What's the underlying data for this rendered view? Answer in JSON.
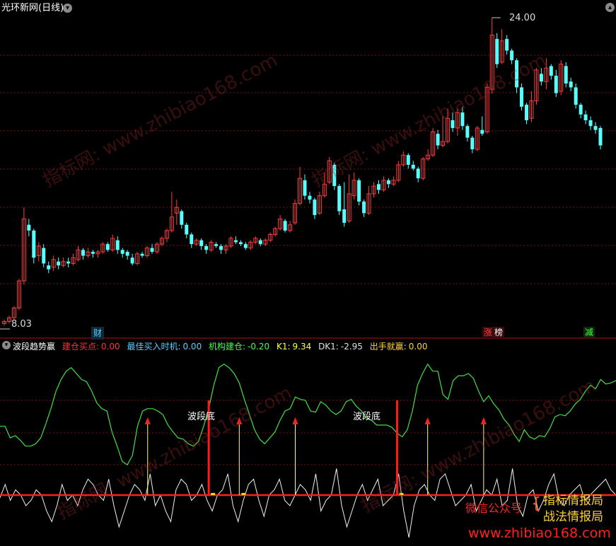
{
  "window": {
    "title": "光环新网(日线)"
  },
  "price_panel": {
    "high_label": "24.00",
    "low_label": "8.03",
    "event_tags": [
      {
        "text": "财",
        "color": "#57d0ff"
      },
      {
        "text": "涨",
        "color": "#ff4040"
      },
      {
        "text": "榜",
        "color": "#ffffff"
      },
      {
        "text": "减",
        "color": "#40ff40"
      }
    ]
  },
  "indicator_panel": {
    "name": "波段趋势赢",
    "fields": [
      {
        "label": "建仓买点:",
        "value": "0.00",
        "color": "#ff3030"
      },
      {
        "label": "最佳买入时机:",
        "value": "0.00",
        "color": "#57d0ff"
      },
      {
        "label": "机构建仓:",
        "value": "-0.20",
        "color": "#40ff40"
      },
      {
        "label": "K1:",
        "value": "9.34",
        "color": "#ffff40"
      },
      {
        "label": "DK1:",
        "value": "-2.95",
        "color": "#e0e0e0"
      },
      {
        "label": "出手就赢:",
        "value": "0.00",
        "color": "#ffd040"
      }
    ],
    "annotations": [
      "波段底",
      "波段底"
    ]
  },
  "watermark": {
    "text": "指标网: www.zhibiao168.com"
  },
  "promo": {
    "wechat": "微信公众号",
    "line1": "指标情报局",
    "line2": "战法情报局",
    "url": "www.zhibiao168.com"
  },
  "colors": {
    "up": "#ff3c3c",
    "down": "#57ffff",
    "grid": "#7a1010"
  },
  "chart_data": {
    "type": "candlestick",
    "price_max": 24.0,
    "price_min": 8.03,
    "candles": [
      [
        8.2,
        8.3,
        8.1,
        8.4
      ],
      [
        8.3,
        8.5,
        8.2,
        8.6
      ],
      [
        8.5,
        9.0,
        8.4,
        9.1
      ],
      [
        9.0,
        10.4,
        8.9,
        10.5
      ],
      [
        10.4,
        13.6,
        10.2,
        14.2
      ],
      [
        13.3,
        13.0,
        12.7,
        13.6
      ],
      [
        13.0,
        11.6,
        11.3,
        13.1
      ],
      [
        11.7,
        12.2,
        11.4,
        12.4
      ],
      [
        12.1,
        11.3,
        11.1,
        12.3
      ],
      [
        11.2,
        11.0,
        10.8,
        11.4
      ],
      [
        11.1,
        11.5,
        10.9,
        11.7
      ],
      [
        11.4,
        11.2,
        11.0,
        11.6
      ],
      [
        11.2,
        11.4,
        11.1,
        11.6
      ],
      [
        11.4,
        11.3,
        11.1,
        11.6
      ],
      [
        11.3,
        11.6,
        11.2,
        11.8
      ],
      [
        11.5,
        12.0,
        11.4,
        12.2
      ],
      [
        12.0,
        11.7,
        11.5,
        12.1
      ],
      [
        11.7,
        11.9,
        11.6,
        12.1
      ],
      [
        11.9,
        11.8,
        11.6,
        12.0
      ],
      [
        11.8,
        11.9,
        11.6,
        12.0
      ],
      [
        11.9,
        12.3,
        11.8,
        12.4
      ],
      [
        12.3,
        12.0,
        11.9,
        12.4
      ],
      [
        12.0,
        12.6,
        11.9,
        12.8
      ],
      [
        12.5,
        12.0,
        11.8,
        12.7
      ],
      [
        12.0,
        11.8,
        11.6,
        12.1
      ],
      [
        11.9,
        11.7,
        11.5,
        12.0
      ],
      [
        11.6,
        11.3,
        11.2,
        11.8
      ],
      [
        11.3,
        11.8,
        11.2,
        11.9
      ],
      [
        11.8,
        11.7,
        11.6,
        11.9
      ],
      [
        11.7,
        12.1,
        11.6,
        12.2
      ],
      [
        12.1,
        11.9,
        11.8,
        12.3
      ],
      [
        11.9,
        12.3,
        11.8,
        12.4
      ],
      [
        12.3,
        12.6,
        12.2,
        12.7
      ],
      [
        12.6,
        13.0,
        12.4,
        13.1
      ],
      [
        13.0,
        13.7,
        12.9,
        15.0
      ],
      [
        13.9,
        14.2,
        13.3,
        14.6
      ],
      [
        14.0,
        13.3,
        13.1,
        14.1
      ],
      [
        13.3,
        12.8,
        12.6,
        13.4
      ],
      [
        12.8,
        12.3,
        12.1,
        12.9
      ],
      [
        12.3,
        12.5,
        12.2,
        12.6
      ],
      [
        12.5,
        12.2,
        12.0,
        12.6
      ],
      [
        12.2,
        12.0,
        11.8,
        12.3
      ],
      [
        12.0,
        12.4,
        11.9,
        12.5
      ],
      [
        12.3,
        12.2,
        12.1,
        12.4
      ],
      [
        12.2,
        12.0,
        11.8,
        12.3
      ],
      [
        12.0,
        12.2,
        11.8,
        12.3
      ],
      [
        12.2,
        12.6,
        12.1,
        12.7
      ],
      [
        12.5,
        12.4,
        12.3,
        12.7
      ],
      [
        12.4,
        12.3,
        12.2,
        12.5
      ],
      [
        12.3,
        12.1,
        12.0,
        12.4
      ],
      [
        12.1,
        12.4,
        12.0,
        12.5
      ],
      [
        12.4,
        12.6,
        12.3,
        12.7
      ],
      [
        12.5,
        12.3,
        12.2,
        12.6
      ],
      [
        12.3,
        12.5,
        12.2,
        12.6
      ],
      [
        12.5,
        12.8,
        12.4,
        12.9
      ],
      [
        12.8,
        13.1,
        12.7,
        13.2
      ],
      [
        13.1,
        13.6,
        13.0,
        13.8
      ],
      [
        13.5,
        13.0,
        12.9,
        13.6
      ],
      [
        13.0,
        13.3,
        12.9,
        13.5
      ],
      [
        13.4,
        14.4,
        13.3,
        14.6
      ],
      [
        14.4,
        15.7,
        14.3,
        16.3
      ],
      [
        15.6,
        14.8,
        14.6,
        15.9
      ],
      [
        14.8,
        14.6,
        14.4,
        15.0
      ],
      [
        14.6,
        13.8,
        13.6,
        14.7
      ],
      [
        13.9,
        14.8,
        13.8,
        15.0
      ],
      [
        14.8,
        15.4,
        14.7,
        16.0
      ],
      [
        15.5,
        16.6,
        15.4,
        16.8
      ],
      [
        16.4,
        15.3,
        15.1,
        16.5
      ],
      [
        15.3,
        14.0,
        13.8,
        15.4
      ],
      [
        14.1,
        13.4,
        13.2,
        15.5
      ],
      [
        13.5,
        14.9,
        13.4,
        15.9
      ],
      [
        14.8,
        15.6,
        14.6,
        16.0
      ],
      [
        15.6,
        14.5,
        14.3,
        15.7
      ],
      [
        14.5,
        13.9,
        13.7,
        14.6
      ],
      [
        13.9,
        14.9,
        13.8,
        15.3
      ],
      [
        14.9,
        15.3,
        14.7,
        15.5
      ],
      [
        15.4,
        15.1,
        14.9,
        15.6
      ],
      [
        15.1,
        15.6,
        15.0,
        15.8
      ],
      [
        15.6,
        15.4,
        15.2,
        15.7
      ],
      [
        15.4,
        15.6,
        15.3,
        15.8
      ],
      [
        15.6,
        16.4,
        15.5,
        16.6
      ],
      [
        16.4,
        16.9,
        16.3,
        17.1
      ],
      [
        16.9,
        16.4,
        16.2,
        17.0
      ],
      [
        16.4,
        16.2,
        16.1,
        16.6
      ],
      [
        16.2,
        15.7,
        15.5,
        16.3
      ],
      [
        15.7,
        16.7,
        15.6,
        16.8
      ],
      [
        16.7,
        16.9,
        16.6,
        17.2
      ],
      [
        16.9,
        18.1,
        16.8,
        18.3
      ],
      [
        18.0,
        17.4,
        17.2,
        18.2
      ],
      [
        17.4,
        17.6,
        17.3,
        18.9
      ],
      [
        17.6,
        18.8,
        17.5,
        19.3
      ],
      [
        18.7,
        18.3,
        18.1,
        19.1
      ],
      [
        18.3,
        19.1,
        17.9,
        19.3
      ],
      [
        19.1,
        18.4,
        18.2,
        19.4
      ],
      [
        18.4,
        17.8,
        17.6,
        18.5
      ],
      [
        17.8,
        17.2,
        17.0,
        17.9
      ],
      [
        17.2,
        18.3,
        17.1,
        18.4
      ],
      [
        18.2,
        18.0,
        17.9,
        18.9
      ],
      [
        18.1,
        20.4,
        18.0,
        20.6
      ],
      [
        20.3,
        23.1,
        20.1,
        24.0
      ],
      [
        22.9,
        21.6,
        21.4,
        23.2
      ],
      [
        21.7,
        22.8,
        21.6,
        23.4
      ],
      [
        22.9,
        22.3,
        22.1,
        23.1
      ],
      [
        22.3,
        21.8,
        21.6,
        22.4
      ],
      [
        21.8,
        20.4,
        20.1,
        21.9
      ],
      [
        20.4,
        19.4,
        19.2,
        20.6
      ],
      [
        19.5,
        18.7,
        18.5,
        19.6
      ],
      [
        18.8,
        19.7,
        18.6,
        20.2
      ],
      [
        19.7,
        21.3,
        19.5,
        21.4
      ],
      [
        21.1,
        20.7,
        20.5,
        21.4
      ],
      [
        20.7,
        21.4,
        20.3,
        21.9
      ],
      [
        21.5,
        21.0,
        20.8,
        21.6
      ],
      [
        21.0,
        20.1,
        19.9,
        21.3
      ],
      [
        20.2,
        21.6,
        20.0,
        21.8
      ],
      [
        21.5,
        20.6,
        20.4,
        21.7
      ],
      [
        20.7,
        20.4,
        20.2,
        20.9
      ],
      [
        20.4,
        19.5,
        19.3,
        20.6
      ],
      [
        19.5,
        19.0,
        18.8,
        19.6
      ],
      [
        19.0,
        18.7,
        18.5,
        19.2
      ],
      [
        18.7,
        18.4,
        18.2,
        18.9
      ],
      [
        18.4,
        18.2,
        18.0,
        18.6
      ],
      [
        18.3,
        17.4,
        17.2,
        18.4
      ]
    ],
    "green_line_series": [
      95,
      95,
      85,
      87,
      83,
      78,
      78,
      80,
      85,
      97,
      110,
      125,
      135,
      142,
      145,
      140,
      135,
      133,
      125,
      115,
      110,
      108,
      90,
      78,
      65,
      62,
      70,
      95,
      108,
      110,
      110,
      108,
      105,
      96,
      90,
      85,
      84,
      80,
      78,
      82,
      95,
      110,
      130,
      145,
      148,
      145,
      140,
      132,
      118,
      105,
      92,
      84,
      80,
      85,
      90,
      100,
      108,
      110,
      120,
      118,
      117,
      108,
      107,
      116,
      113,
      108,
      105,
      108,
      116,
      118,
      112,
      108,
      102,
      100,
      96,
      96,
      96,
      94,
      89,
      86,
      92,
      108,
      130,
      140,
      148,
      142,
      142,
      122,
      118,
      134,
      138,
      138,
      140,
      136,
      125,
      116,
      121,
      114,
      109,
      101,
      96,
      88,
      82,
      92,
      86,
      84,
      87,
      86,
      93,
      103,
      105,
      104,
      108,
      114,
      118,
      125,
      130,
      127,
      135,
      131,
      132,
      134
    ],
    "white_line_series": [
      -0.5,
      2,
      -1,
      1,
      0,
      -2,
      -1,
      1,
      0,
      -3,
      -5,
      -2,
      2,
      -1,
      0,
      -2,
      1,
      3,
      2,
      0,
      -1,
      3,
      -2,
      -6,
      -3,
      0,
      2,
      1,
      -1,
      4,
      -2,
      0,
      -3,
      -5,
      1,
      3,
      2,
      -1,
      0,
      2,
      -1,
      -3,
      0,
      1,
      4,
      -2,
      -5,
      -1,
      2,
      3,
      -1,
      -4,
      0,
      1,
      3,
      -1,
      -2,
      0,
      2,
      1,
      -1,
      4,
      -3,
      -1,
      0,
      5,
      -2,
      -6,
      -3,
      0,
      2,
      -1,
      1,
      3,
      -2,
      -1,
      0,
      4,
      -3,
      -8,
      -2,
      1,
      2,
      0,
      -1,
      3,
      4,
      1,
      -2,
      -1,
      0,
      2,
      -3,
      -1,
      1,
      0,
      3,
      -2,
      -1,
      5,
      -2,
      -4,
      0,
      1,
      -3,
      -1,
      2,
      4,
      -1,
      -2,
      0,
      1,
      2,
      -1,
      0,
      1,
      2,
      3,
      1,
      0
    ],
    "markers": {
      "red_bars": [
        41,
        78
      ],
      "yellow_arrows": [
        29,
        47,
        58,
        84,
        95,
        122
      ]
    }
  }
}
